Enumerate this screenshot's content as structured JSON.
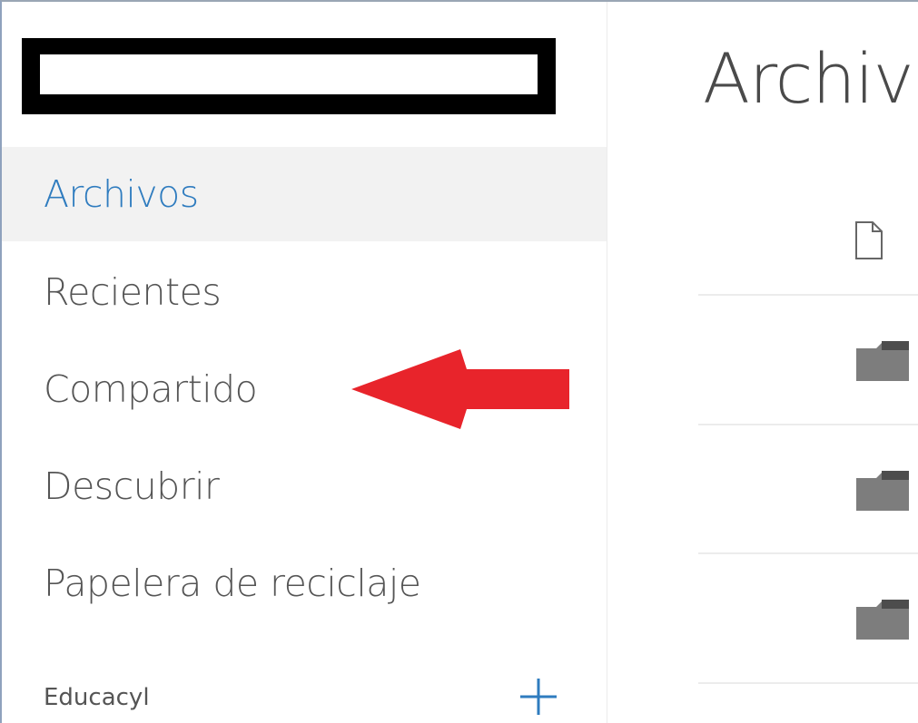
{
  "sidebar": {
    "logo_redacted": true,
    "items": [
      {
        "label": "Archivos",
        "active": true
      },
      {
        "label": "Recientes",
        "active": false
      },
      {
        "label": "Compartido",
        "active": false
      },
      {
        "label": "Descubrir",
        "active": false
      },
      {
        "label": "Papelera de reciclaje",
        "active": false
      }
    ],
    "section": {
      "label": "Educacyl",
      "add_icon": "plus-icon"
    }
  },
  "annotation": {
    "arrow_color": "#e8242b",
    "points_to": "Compartido"
  },
  "main": {
    "title": "Archiv",
    "header_icon": "file-icon",
    "rows": [
      {
        "icon": "folder-icon"
      },
      {
        "icon": "folder-icon"
      },
      {
        "icon": "folder-icon"
      }
    ]
  },
  "colors": {
    "accent": "#2f7cbf",
    "active_bg": "#f2f2f2",
    "text": "#555555"
  }
}
